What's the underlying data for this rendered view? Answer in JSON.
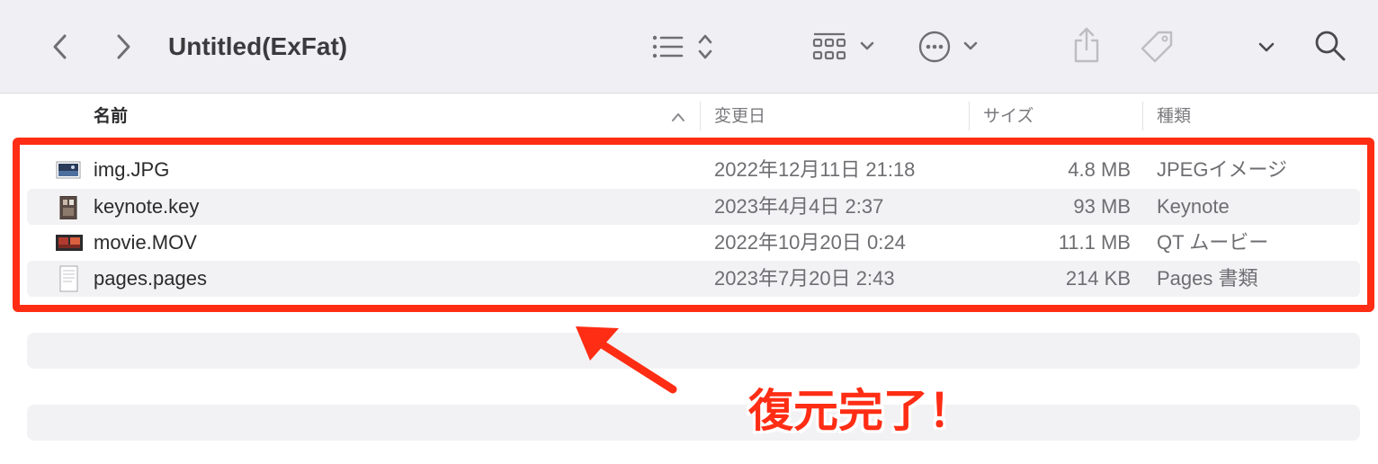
{
  "window": {
    "title": "Untitled(ExFat)"
  },
  "toolbar": {
    "back_icon": "chevron-left-icon",
    "forward_icon": "chevron-right-icon",
    "view_icon": "list-view-icon",
    "group_icon": "grid-group-icon",
    "action_icon": "ellipsis-circle-icon",
    "share_icon": "share-icon",
    "tag_icon": "tag-icon",
    "more_icon": "chevron-down-icon",
    "search_icon": "magnifier-icon"
  },
  "columns": {
    "name": "名前",
    "date": "変更日",
    "size": "サイズ",
    "kind": "種類"
  },
  "files": [
    {
      "name": "img.JPG",
      "date": "2022年12月11日 21:18",
      "size": "4.8 MB",
      "kind": "JPEGイメージ",
      "icon": "jpg-file-icon"
    },
    {
      "name": "keynote.key",
      "date": "2023年4月4日 2:37",
      "size": "93 MB",
      "kind": "Keynote",
      "icon": "keynote-file-icon"
    },
    {
      "name": "movie.MOV",
      "date": "2022年10月20日 0:24",
      "size": "11.1 MB",
      "kind": "QT ムービー",
      "icon": "mov-file-icon"
    },
    {
      "name": "pages.pages",
      "date": "2023年7月20日 2:43",
      "size": "214 KB",
      "kind": "Pages 書類",
      "icon": "pages-file-icon"
    }
  ],
  "annotation": {
    "callout": "復元完了！",
    "color": "#ff2d14"
  },
  "colors": {
    "toolbar_bg": "#f0eff4",
    "text": "#2b2b2d",
    "secondary_text": "#6e6e72",
    "accent_red": "#ff2d14"
  }
}
